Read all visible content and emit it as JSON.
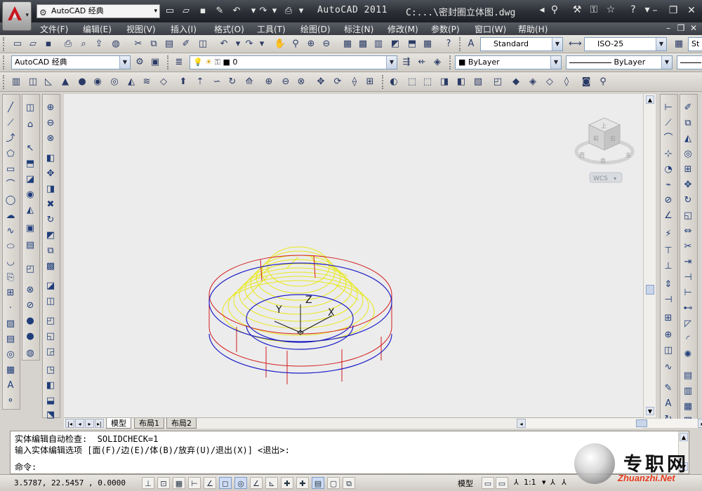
{
  "titlebar": {
    "workspace": "AutoCAD 经典",
    "app_title": "AutoCAD 2011",
    "file_title": "C:...\\密封圈立体图.dwg"
  },
  "menu": [
    "文件(F)",
    "编辑(E)",
    "视图(V)",
    "插入(I)",
    "格式(O)",
    "工具(T)",
    "绘图(D)",
    "标注(N)",
    "修改(M)",
    "参数(P)",
    "窗口(W)",
    "帮助(H)"
  ],
  "styles_toolbar": {
    "text_style": "Standard",
    "dim_style": "ISO-25",
    "table_style": "St"
  },
  "layers_toolbar": {
    "workspace": "AutoCAD 经典",
    "current_layer": "0",
    "color": "ByLayer",
    "linetype": "ByLayer"
  },
  "viewcube": {
    "top": "上",
    "face_left": "前",
    "face_right": "右",
    "compass_w": "西",
    "compass_s": "南",
    "compass_e": "东",
    "wcs": "WCS"
  },
  "drawing_labels": {
    "x": "X",
    "y": "Y",
    "z": "Z"
  },
  "layout_tabs": [
    "模型",
    "布局1",
    "布局2"
  ],
  "command": {
    "line1": "实体编辑自动检查:  SOLIDCHECK=1",
    "line2": "输入实体编辑选项 [面(F)/边(E)/体(B)/放弃(U)/退出(X)] <退出>:",
    "prompt": "命令:"
  },
  "status": {
    "coords": "3.5787,   22.5457 , 0.0000",
    "model_label": "模型",
    "scale": "1:1"
  },
  "watermark": {
    "cn": "专职网",
    "en": "Zhuanzhi.Net"
  },
  "colors": {
    "outer_ring": "#d21c1c",
    "inner_ring": "#1d1dc8",
    "cone": "#e8e81a",
    "ucs": "#1a1a1a"
  }
}
